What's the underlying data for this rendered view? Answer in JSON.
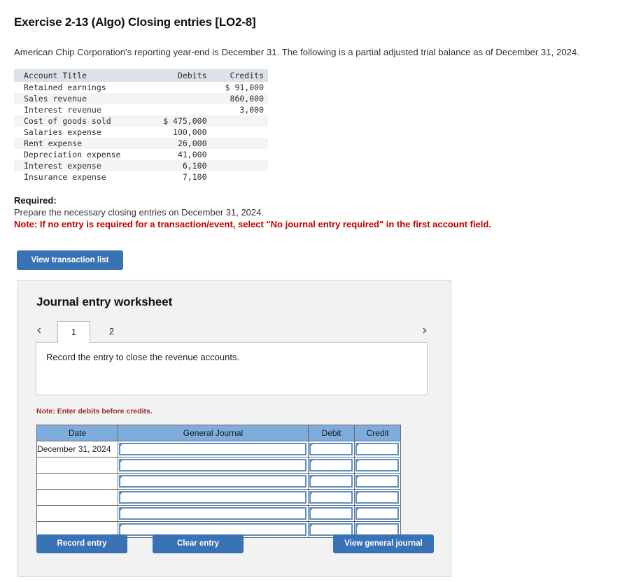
{
  "exercise": {
    "title": "Exercise 2-13 (Algo) Closing entries [LO2-8]",
    "intro": "American Chip Corporation's reporting year-end is December 31. The following is a partial adjusted trial balance as of December 31, 2024."
  },
  "trial_balance": {
    "columns": [
      "Account Title",
      "Debits",
      "Credits"
    ],
    "rows": [
      {
        "account": "Retained earnings",
        "debits": "",
        "credits": "$ 91,000"
      },
      {
        "account": "Sales revenue",
        "debits": "",
        "credits": "860,000"
      },
      {
        "account": "Interest revenue",
        "debits": "",
        "credits": "3,000"
      },
      {
        "account": "Cost of goods sold",
        "debits": "$ 475,000",
        "credits": ""
      },
      {
        "account": "Salaries expense",
        "debits": "100,000",
        "credits": ""
      },
      {
        "account": "Rent expense",
        "debits": "26,000",
        "credits": ""
      },
      {
        "account": "Depreciation expense",
        "debits": "41,000",
        "credits": ""
      },
      {
        "account": "Interest expense",
        "debits": "6,100",
        "credits": ""
      },
      {
        "account": "Insurance expense",
        "debits": "7,100",
        "credits": ""
      }
    ]
  },
  "required": {
    "label": "Required:",
    "text": "Prepare the necessary closing entries on December 31, 2024.",
    "note": "Note: If no entry is required for a transaction/event, select \"No journal entry required\" in the first account field.",
    "note_color": "#c00000"
  },
  "view_transaction_button": "View transaction list",
  "worksheet": {
    "title": "Journal entry worksheet",
    "prev_icon": "chevron-left-icon",
    "next_icon": "chevron-right-icon",
    "prev_glyph": "‹",
    "next_glyph": "›",
    "tabs": [
      {
        "label": "1",
        "active": true
      },
      {
        "label": "2",
        "active": false
      }
    ],
    "description": "Record the entry to close the revenue accounts.",
    "debits_note": "Note: Enter debits before credits.",
    "debits_note_color": "#9a2a2a",
    "table": {
      "columns": [
        "Date",
        "General Journal",
        "Debit",
        "Credit"
      ],
      "header_color": "#7dacdd",
      "rows": [
        {
          "date": "December 31, 2024",
          "journal": "",
          "debit": "",
          "credit": ""
        },
        {
          "date": "",
          "journal": "",
          "debit": "",
          "credit": ""
        },
        {
          "date": "",
          "journal": "",
          "debit": "",
          "credit": ""
        },
        {
          "date": "",
          "journal": "",
          "debit": "",
          "credit": ""
        },
        {
          "date": "",
          "journal": "",
          "debit": "",
          "credit": ""
        },
        {
          "date": "",
          "journal": "",
          "debit": "",
          "credit": ""
        }
      ]
    },
    "buttons": {
      "record": "Record entry",
      "clear": "Clear entry",
      "view_general_journal": "View general journal",
      "color": "#3a72b6"
    }
  }
}
